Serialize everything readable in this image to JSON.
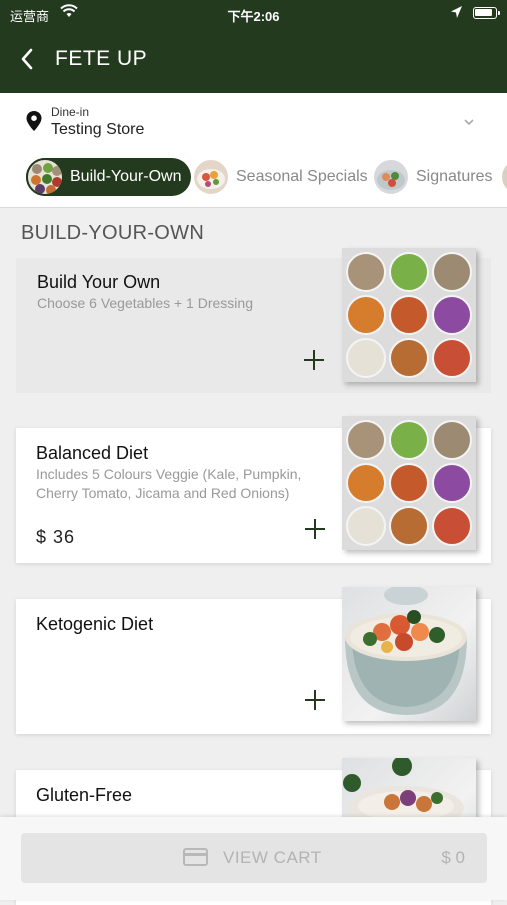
{
  "status_bar": {
    "carrier": "运营商",
    "time": "下午2:06"
  },
  "header": {
    "title": "FETE UP"
  },
  "store": {
    "mode": "Dine-in",
    "name": "Testing Store"
  },
  "tabs": [
    {
      "label": "Build-Your-Own",
      "active": true
    },
    {
      "label": "Seasonal Specials",
      "active": false
    },
    {
      "label": "Signatures",
      "active": false
    }
  ],
  "section": {
    "title": "BUILD-YOUR-OWN"
  },
  "items": [
    {
      "title": "Build Your Own",
      "description": "Choose 6 Vegetables + 1 Dressing",
      "price": ""
    },
    {
      "title": "Balanced Diet",
      "description": "Includes 5 Colours Veggie (Kale, Pumpkin, Cherry Tomato, Jicama and Red Onions)",
      "price": "$ 36"
    },
    {
      "title": "Ketogenic Diet",
      "description": "",
      "price": ""
    },
    {
      "title": "Gluten-Free",
      "description": "",
      "price": ""
    }
  ],
  "cart": {
    "label": "VIEW CART",
    "total": "$ 0"
  },
  "colors": {
    "primary": "#233a1f",
    "background": "#efefef"
  },
  "icons": [
    "wifi-icon",
    "location-arrow-icon",
    "battery-icon",
    "back-icon",
    "map-pin-icon",
    "chevron-down-icon",
    "add-icon",
    "credit-card-icon"
  ]
}
